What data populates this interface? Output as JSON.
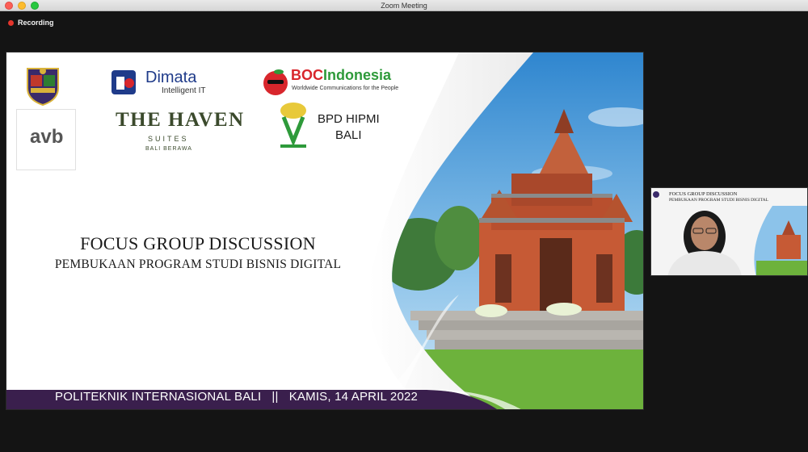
{
  "window": {
    "title": "Zoom Meeting"
  },
  "status": {
    "recording_label": "Recording"
  },
  "slide": {
    "logos": {
      "dimata": {
        "name": "Dimata",
        "tagline": "Intelligent IT"
      },
      "boc": {
        "name_prefix": "BOC",
        "name_suffix": "Indonesia",
        "tagline": "Worldwide Communications for the People"
      },
      "haven": {
        "name": "THE HAVEN",
        "suites": "SUITES",
        "location": "BALI BERAWA"
      },
      "hipmi": {
        "line1": "BPD HIPMI",
        "line2": "BALI"
      },
      "avb": {
        "name": "avb"
      }
    },
    "title": "FOCUS GROUP DISCUSSION",
    "subtitle": "PEMBUKAAN PROGRAM STUDI BISNIS DIGITAL",
    "footer": "POLITEKNIK INTERNASIONAL BALI   ||   KAMIS, 14 APRIL 2022",
    "colors": {
      "footer_purple": "#3a1f4d",
      "boc_red": "#d8262c",
      "boc_green": "#2e9a3a",
      "dimata_blue": "#1f3b8a",
      "haven_green": "#3b4a2c"
    }
  },
  "participant": {
    "slide_title": "FOCUS GROUP DISCUSSION",
    "slide_subtitle": "PEMBUKAAN PROGRAM STUDI BISNIS DIGITAL"
  }
}
